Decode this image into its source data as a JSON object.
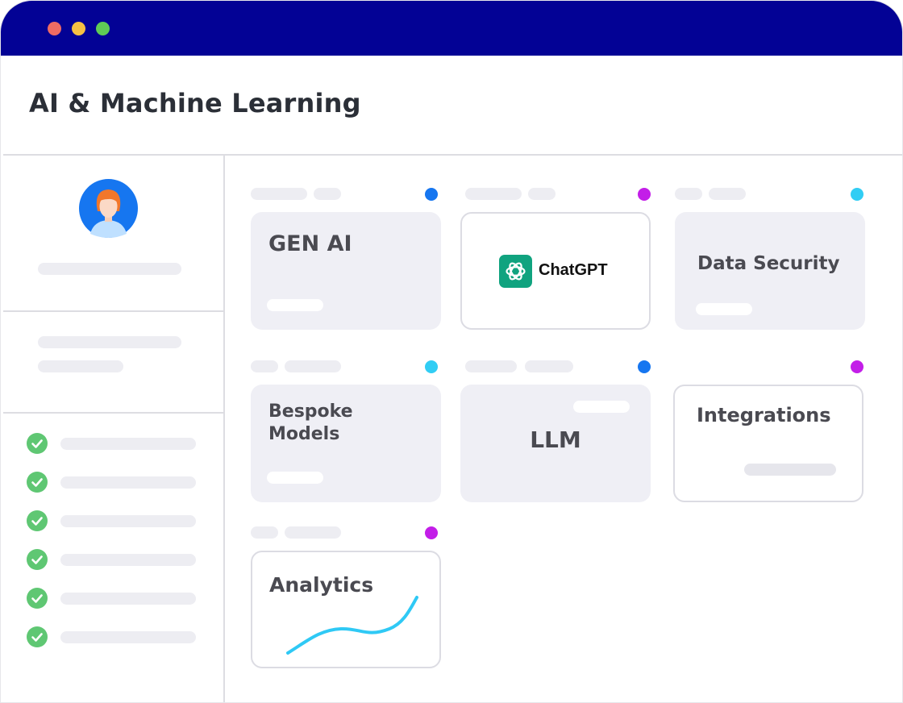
{
  "window": {
    "traffic_lights": {
      "close_color": "#ef6b63",
      "minimize_color": "#f6c143",
      "maximize_color": "#5fcb56"
    },
    "titlebar_color": "#030295"
  },
  "header": {
    "title": "AI & Machine Learning"
  },
  "sidebar": {
    "avatar_icon": "user-avatar-icon",
    "checklist_count": 6,
    "check_icon": "check-circle-icon",
    "check_color": "#5fc773"
  },
  "cards": {
    "gen_ai": {
      "label": "GEN AI",
      "status_color": "#1676f0"
    },
    "chatgpt": {
      "label": "ChatGPT",
      "logo_icon": "openai-logo-icon",
      "logo_color": "#10a37f",
      "status_color": "#c31ee8"
    },
    "data_security": {
      "label": "Data Security",
      "status_color": "#31cdf4"
    },
    "bespoke_models": {
      "label_line1": "Bespoke",
      "label_line2": "Models",
      "status_color": "#31cdf4"
    },
    "llm": {
      "label": "LLM",
      "status_color": "#1676f0"
    },
    "integrations": {
      "label": "Integrations",
      "status_color": "#c31ee8"
    },
    "analytics": {
      "label": "Analytics",
      "status_color": "#c31ee8",
      "trend_icon": "trend-line-icon",
      "trend_color": "#2fc9f5"
    }
  }
}
